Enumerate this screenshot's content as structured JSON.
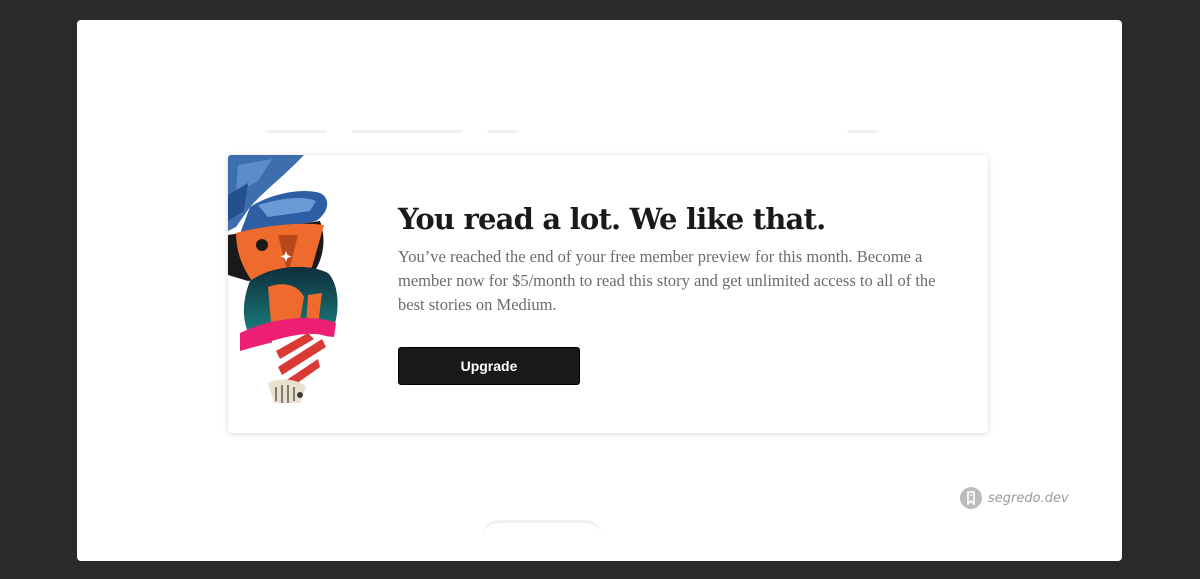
{
  "modal": {
    "headline": "You read a lot. We like that.",
    "body": "You’ve reached the end of your free member preview for this month. Become a member now for $5/month to read this story and get unlimited access to all of the best stories on Medium.",
    "upgrade_label": "Upgrade",
    "illustration": "abstract-collage-illustration"
  },
  "watermark": {
    "icon": "segredo-logo-icon",
    "text": "segredo.dev"
  },
  "colors": {
    "backdrop": "#2a2a2a",
    "page": "#ffffff",
    "button_bg": "#191919",
    "button_text": "#ffffff",
    "headline": "#1a1a1a",
    "body_text": "#6b6b6b",
    "illustration_blue": "#3f6fb6",
    "illustration_orange": "#ee6b2d",
    "illustration_pink": "#ec1f74",
    "illustration_teal": "#1a8f8c"
  }
}
